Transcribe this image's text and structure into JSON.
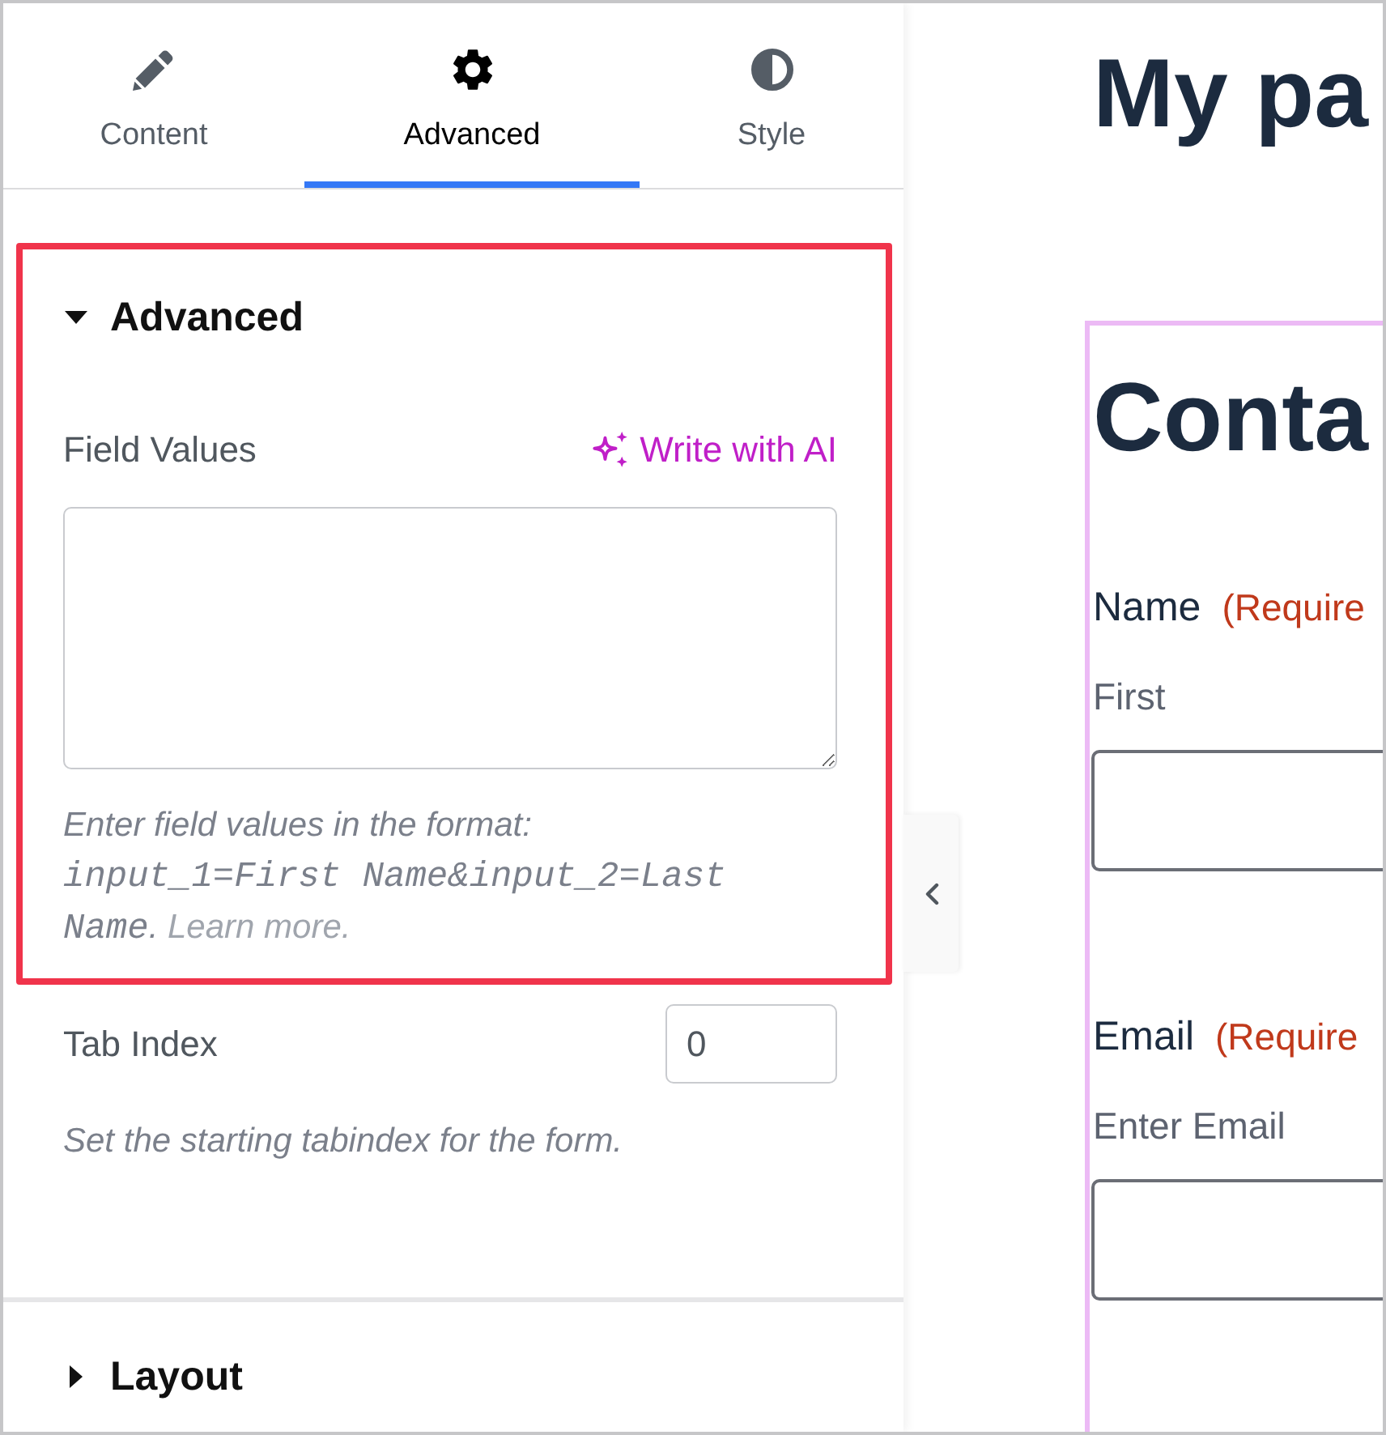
{
  "tabs": [
    {
      "label": "Content",
      "selected": false
    },
    {
      "label": "Advanced",
      "selected": true
    },
    {
      "label": "Style",
      "selected": false
    }
  ],
  "sections": [
    {
      "title": "Advanced",
      "expanded": true,
      "highlighted": true,
      "controls": [
        {
          "kind": "textarea",
          "label": "Field Values",
          "highlighted": true,
          "action": "Write with AI",
          "help": [
            {
              "kind": "text",
              "text": "Enter field values in the format: "
            },
            {
              "kind": "code",
              "text": "input_1=First Name&input_2=Last Name"
            },
            {
              "kind": "text",
              "text": ". "
            },
            {
              "kind": "link",
              "text": "Learn more."
            }
          ]
        },
        {
          "kind": "number",
          "label": "Tab Index",
          "highlighted": false,
          "value": "0",
          "help": [
            {
              "kind": "text",
              "text": "Set the starting tabindex for the form."
            }
          ]
        }
      ]
    },
    {
      "title": "Layout",
      "expanded": false,
      "highlighted": false
    }
  ],
  "preview": {
    "page_title": "My pa",
    "form": {
      "title": "Conta",
      "fields": [
        {
          "label": "Name",
          "required": "(Require",
          "sublabel": "First"
        },
        {
          "label": "Email",
          "required": "(Require",
          "sublabel": "Enter Email"
        }
      ]
    }
  }
}
